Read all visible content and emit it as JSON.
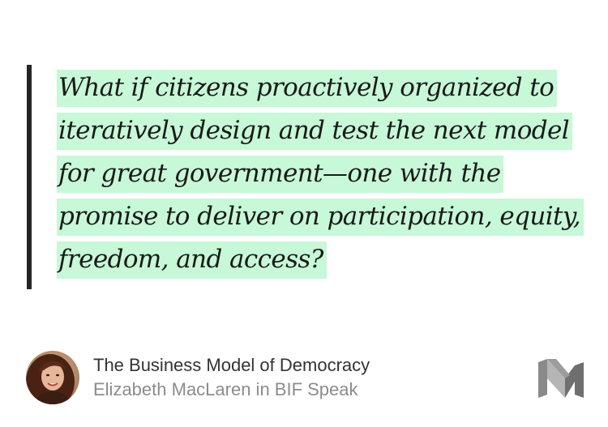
{
  "quote": {
    "lines": [
      "What if citizens proactively organized to",
      "iteratively design and test the next model",
      "for great government—one with the",
      "promise to deliver on participation, equity,",
      "freedom, and access?"
    ],
    "highlight_color": "#c7f8d7",
    "bar_color": "#262626"
  },
  "article": {
    "title": "The Business Model of Democracy",
    "byline": "Elizabeth MacLaren in BIF Speak"
  },
  "icons": {
    "avatar": "author-avatar",
    "logo": "medium-logo-icon"
  }
}
